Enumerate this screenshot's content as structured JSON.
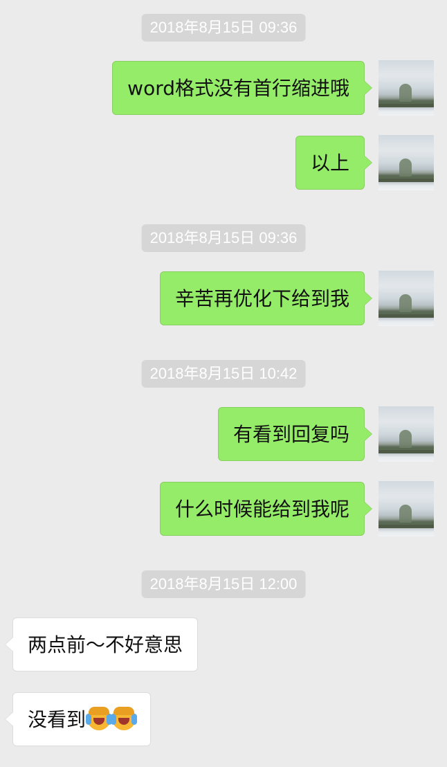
{
  "timestamps": {
    "t1": "2018年8月15日 09:36",
    "t2": "2018年8月15日 09:36",
    "t3": "2018年8月15日 10:42",
    "t4": "2018年8月15日 12:00"
  },
  "messages": {
    "m1": "word格式没有首行缩进哦",
    "m2": "以上",
    "m3": "辛苦再优化下给到我",
    "m4": "有看到回复吗",
    "m5": "什么时候能给到我呢",
    "m6": "两点前～不好意思",
    "m7": "没看到"
  },
  "icons": {
    "emoji": "face-palm-crying-emoji"
  },
  "colors": {
    "background": "#ebebeb",
    "sent_bubble": "#95ec69",
    "received_bubble": "#ffffff",
    "timestamp_bg": "#d6d6d6"
  }
}
